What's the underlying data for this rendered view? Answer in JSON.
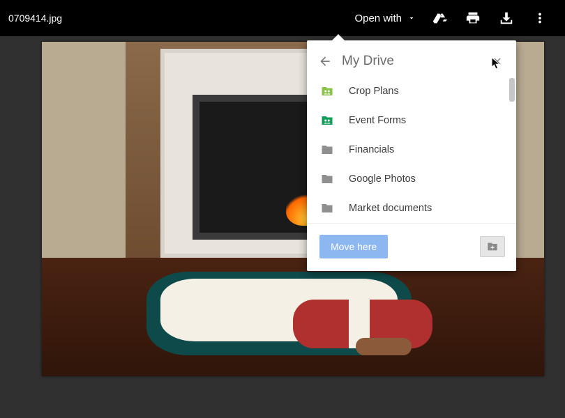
{
  "topbar": {
    "filename": "0709414.jpg",
    "open_with_label": "Open with"
  },
  "popover": {
    "title": "My Drive",
    "move_button_label": "Move here",
    "folders": [
      {
        "label": "Crop Plans",
        "shared": true,
        "color": "#8bc34a"
      },
      {
        "label": "Event Forms",
        "shared": true,
        "color": "#0f9d58"
      },
      {
        "label": "Financials",
        "shared": false,
        "color": "#8f8f8f"
      },
      {
        "label": "Google Photos",
        "shared": false,
        "color": "#8f8f8f"
      },
      {
        "label": "Market documents",
        "shared": false,
        "color": "#8f8f8f"
      }
    ]
  }
}
